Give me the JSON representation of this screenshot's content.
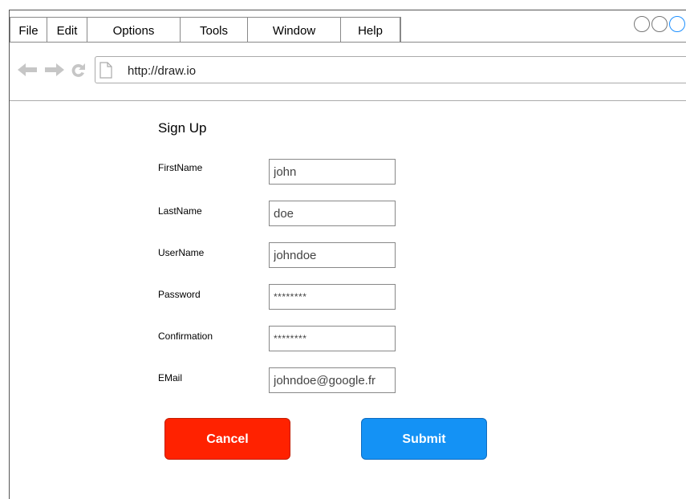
{
  "menu": {
    "items": [
      {
        "label": "File"
      },
      {
        "label": "Edit"
      },
      {
        "label": "Options"
      },
      {
        "label": "Tools"
      },
      {
        "label": "Window"
      },
      {
        "label": "Help"
      }
    ]
  },
  "browser": {
    "url": "http://draw.io",
    "nav_icons": [
      "back-arrow-icon",
      "forward-arrow-icon",
      "reload-icon",
      "page-icon"
    ]
  },
  "form": {
    "title": "Sign Up",
    "fields": [
      {
        "label": "FirstName",
        "value": "john"
      },
      {
        "label": "LastName",
        "value": "doe"
      },
      {
        "label": "UserName",
        "value": "johndoe"
      },
      {
        "label": "Password",
        "value": "********"
      },
      {
        "label": "Confirmation",
        "value": "********"
      },
      {
        "label": "EMail",
        "value": "johndoe@google.fr"
      }
    ],
    "cancel_label": "Cancel",
    "submit_label": "Submit"
  },
  "colors": {
    "cancel": "#ff2200",
    "submit": "#1492f5",
    "window_control_accent": "#1e90ff"
  }
}
